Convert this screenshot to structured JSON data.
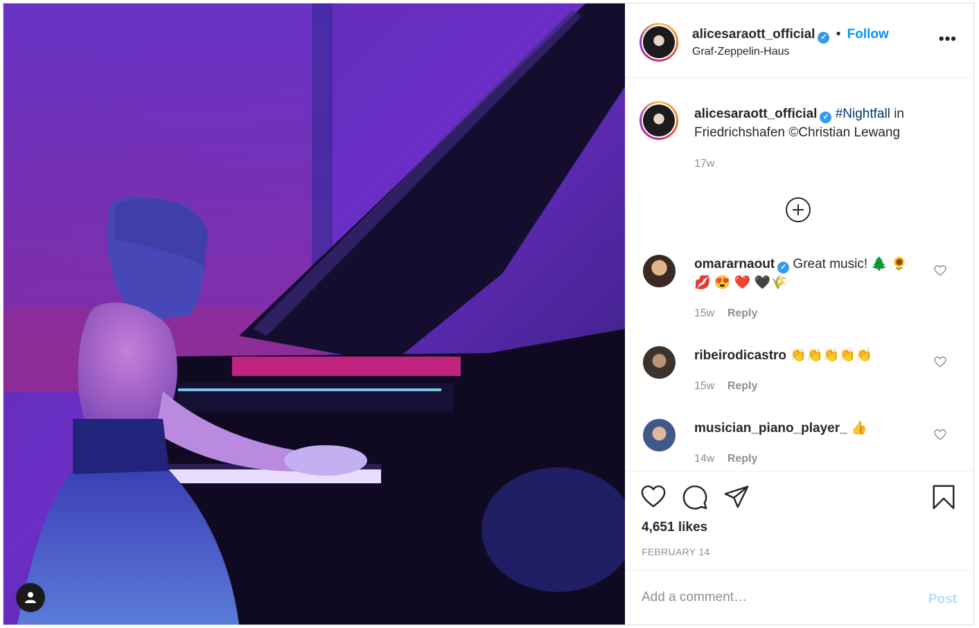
{
  "post": {
    "username": "alicesaraott_official",
    "verified_mark": "✓",
    "separator": "•",
    "follow_label": "Follow",
    "location": "Graf-Zeppelin-Haus",
    "more_icon": "more-options-icon"
  },
  "caption": {
    "username": "alicesaraott_official",
    "hashtag": "#Nightfall",
    "text_after_hashtag": " in Friedrichshafen ©Christian Lewang",
    "time": "17w"
  },
  "comments": [
    {
      "username": "omararnaout",
      "verified": true,
      "text": "Great music! 🌲 🌻 💋 😍 ❤️ 🖤🌾",
      "time": "15w",
      "reply_label": "Reply"
    },
    {
      "username": "ribeirodicastro",
      "verified": false,
      "text": "👏👏👏👏👏",
      "time": "15w",
      "reply_label": "Reply"
    },
    {
      "username": "musician_piano_player_",
      "verified": false,
      "text": "👍",
      "time": "14w",
      "reply_label": "Reply"
    }
  ],
  "engagement": {
    "likes": "4,651 likes",
    "date": "FEBRUARY 14"
  },
  "comment_box": {
    "placeholder": "Add a comment…",
    "post_label": "Post"
  },
  "colors": {
    "accent": "#0095f6",
    "verified": "#3897f0",
    "hashtag": "#00376b",
    "muted": "#8e8e8e"
  }
}
